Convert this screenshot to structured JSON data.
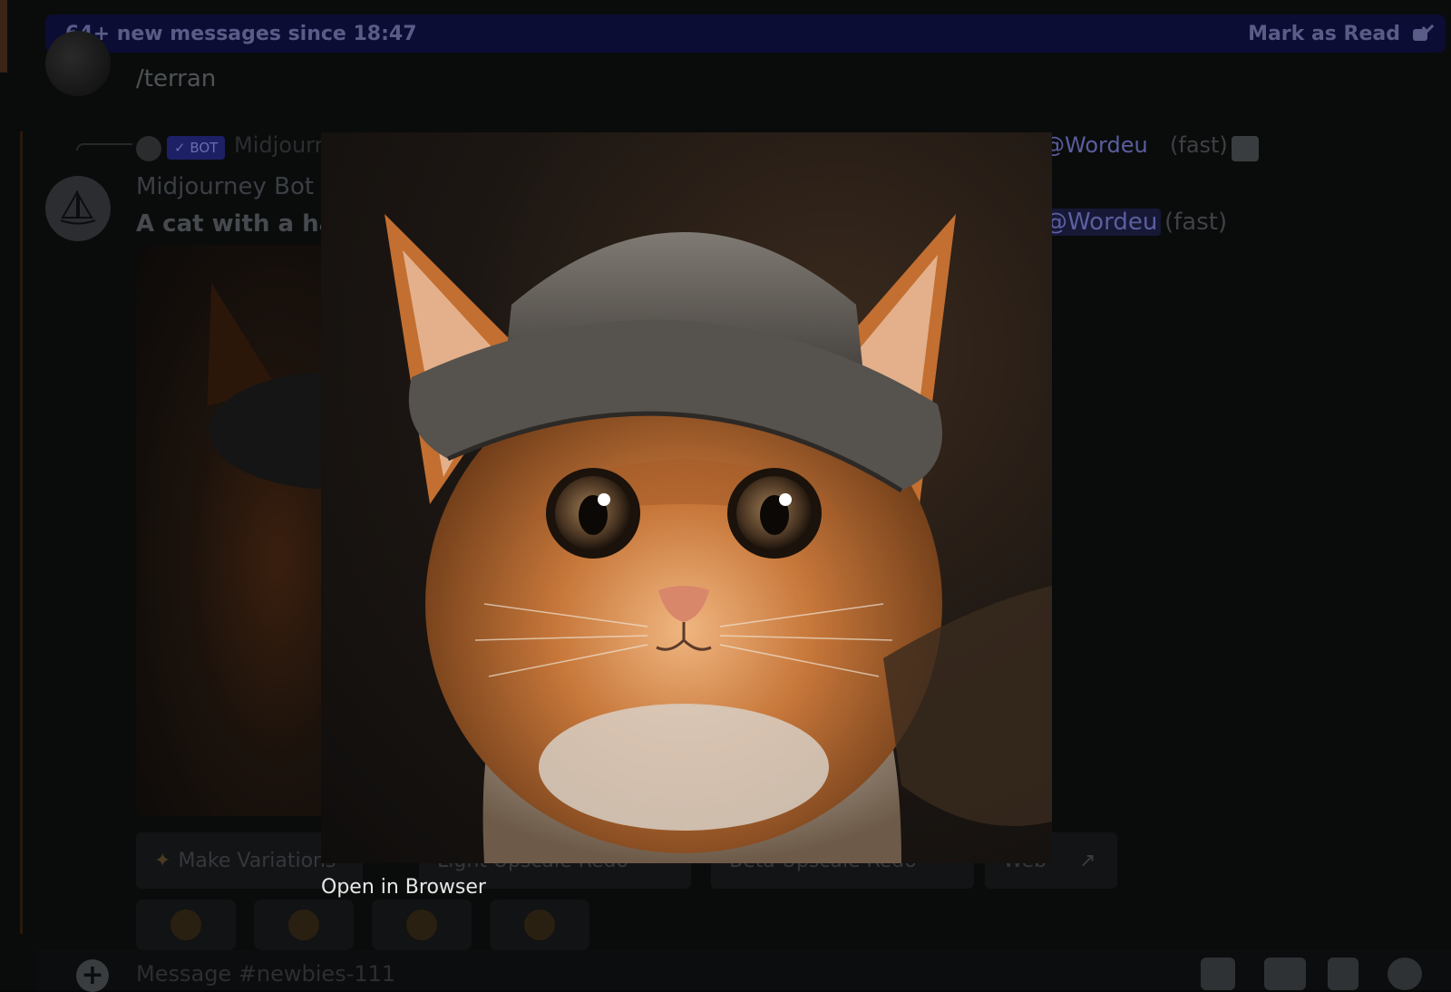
{
  "banner": {
    "text": "64+ new messages since 18:47",
    "action_label": "Mark as Read"
  },
  "previous_message": {
    "text": "/terran"
  },
  "reply_preview": {
    "badge": "✓ BOT",
    "author": "Midjourney Bot",
    "mention": "@Wordeu",
    "speed": "(fast)"
  },
  "message": {
    "author": "Midjourney Bot",
    "prompt": "A cat with a hat",
    "mention": "@Wordeu",
    "speed": "(fast)"
  },
  "buttons": [
    {
      "label": "Make Variations",
      "icon": "wand-icon"
    },
    {
      "label": "Light Upscale Redo",
      "icon": "magnifier-icon"
    },
    {
      "label": "Beta Upscale Redo",
      "icon": "magnifier-icon"
    },
    {
      "label": "Web",
      "icon": "external-link-icon"
    }
  ],
  "reactions": [
    "confounded-face",
    "unamused-face",
    "grinning-face",
    "heart-eyes-face"
  ],
  "composer": {
    "placeholder": "Message #newbies-111"
  },
  "viewer": {
    "open_in_browser_label": "Open in Browser",
    "image_subject": "orange kitten wearing a gray cap"
  },
  "colors": {
    "banner_bg": "#0c0d34",
    "overlay_bg": "#060808",
    "mention": "#5a5d9e"
  }
}
